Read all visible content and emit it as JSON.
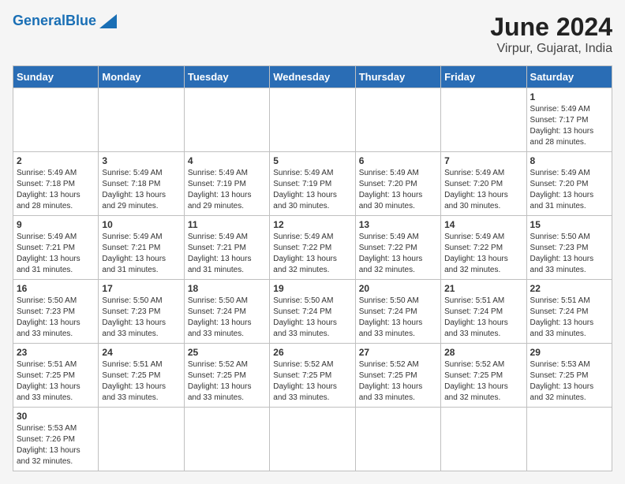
{
  "header": {
    "logo_general": "General",
    "logo_blue": "Blue",
    "month_year": "June 2024",
    "location": "Virpur, Gujarat, India"
  },
  "weekdays": [
    "Sunday",
    "Monday",
    "Tuesday",
    "Wednesday",
    "Thursday",
    "Friday",
    "Saturday"
  ],
  "weeks": [
    [
      {
        "day": null,
        "info": null
      },
      {
        "day": null,
        "info": null
      },
      {
        "day": null,
        "info": null
      },
      {
        "day": null,
        "info": null
      },
      {
        "day": null,
        "info": null
      },
      {
        "day": null,
        "info": null
      },
      {
        "day": "1",
        "info": "Sunrise: 5:49 AM\nSunset: 7:17 PM\nDaylight: 13 hours\nand 28 minutes."
      }
    ],
    [
      {
        "day": "2",
        "info": "Sunrise: 5:49 AM\nSunset: 7:18 PM\nDaylight: 13 hours\nand 28 minutes."
      },
      {
        "day": "3",
        "info": "Sunrise: 5:49 AM\nSunset: 7:18 PM\nDaylight: 13 hours\nand 29 minutes."
      },
      {
        "day": "4",
        "info": "Sunrise: 5:49 AM\nSunset: 7:19 PM\nDaylight: 13 hours\nand 29 minutes."
      },
      {
        "day": "5",
        "info": "Sunrise: 5:49 AM\nSunset: 7:19 PM\nDaylight: 13 hours\nand 30 minutes."
      },
      {
        "day": "6",
        "info": "Sunrise: 5:49 AM\nSunset: 7:20 PM\nDaylight: 13 hours\nand 30 minutes."
      },
      {
        "day": "7",
        "info": "Sunrise: 5:49 AM\nSunset: 7:20 PM\nDaylight: 13 hours\nand 30 minutes."
      },
      {
        "day": "8",
        "info": "Sunrise: 5:49 AM\nSunset: 7:20 PM\nDaylight: 13 hours\nand 31 minutes."
      }
    ],
    [
      {
        "day": "9",
        "info": "Sunrise: 5:49 AM\nSunset: 7:21 PM\nDaylight: 13 hours\nand 31 minutes."
      },
      {
        "day": "10",
        "info": "Sunrise: 5:49 AM\nSunset: 7:21 PM\nDaylight: 13 hours\nand 31 minutes."
      },
      {
        "day": "11",
        "info": "Sunrise: 5:49 AM\nSunset: 7:21 PM\nDaylight: 13 hours\nand 31 minutes."
      },
      {
        "day": "12",
        "info": "Sunrise: 5:49 AM\nSunset: 7:22 PM\nDaylight: 13 hours\nand 32 minutes."
      },
      {
        "day": "13",
        "info": "Sunrise: 5:49 AM\nSunset: 7:22 PM\nDaylight: 13 hours\nand 32 minutes."
      },
      {
        "day": "14",
        "info": "Sunrise: 5:49 AM\nSunset: 7:22 PM\nDaylight: 13 hours\nand 32 minutes."
      },
      {
        "day": "15",
        "info": "Sunrise: 5:50 AM\nSunset: 7:23 PM\nDaylight: 13 hours\nand 33 minutes."
      }
    ],
    [
      {
        "day": "16",
        "info": "Sunrise: 5:50 AM\nSunset: 7:23 PM\nDaylight: 13 hours\nand 33 minutes."
      },
      {
        "day": "17",
        "info": "Sunrise: 5:50 AM\nSunset: 7:23 PM\nDaylight: 13 hours\nand 33 minutes."
      },
      {
        "day": "18",
        "info": "Sunrise: 5:50 AM\nSunset: 7:24 PM\nDaylight: 13 hours\nand 33 minutes."
      },
      {
        "day": "19",
        "info": "Sunrise: 5:50 AM\nSunset: 7:24 PM\nDaylight: 13 hours\nand 33 minutes."
      },
      {
        "day": "20",
        "info": "Sunrise: 5:50 AM\nSunset: 7:24 PM\nDaylight: 13 hours\nand 33 minutes."
      },
      {
        "day": "21",
        "info": "Sunrise: 5:51 AM\nSunset: 7:24 PM\nDaylight: 13 hours\nand 33 minutes."
      },
      {
        "day": "22",
        "info": "Sunrise: 5:51 AM\nSunset: 7:24 PM\nDaylight: 13 hours\nand 33 minutes."
      }
    ],
    [
      {
        "day": "23",
        "info": "Sunrise: 5:51 AM\nSunset: 7:25 PM\nDaylight: 13 hours\nand 33 minutes."
      },
      {
        "day": "24",
        "info": "Sunrise: 5:51 AM\nSunset: 7:25 PM\nDaylight: 13 hours\nand 33 minutes."
      },
      {
        "day": "25",
        "info": "Sunrise: 5:52 AM\nSunset: 7:25 PM\nDaylight: 13 hours\nand 33 minutes."
      },
      {
        "day": "26",
        "info": "Sunrise: 5:52 AM\nSunset: 7:25 PM\nDaylight: 13 hours\nand 33 minutes."
      },
      {
        "day": "27",
        "info": "Sunrise: 5:52 AM\nSunset: 7:25 PM\nDaylight: 13 hours\nand 33 minutes."
      },
      {
        "day": "28",
        "info": "Sunrise: 5:52 AM\nSunset: 7:25 PM\nDaylight: 13 hours\nand 32 minutes."
      },
      {
        "day": "29",
        "info": "Sunrise: 5:53 AM\nSunset: 7:25 PM\nDaylight: 13 hours\nand 32 minutes."
      }
    ],
    [
      {
        "day": "30",
        "info": "Sunrise: 5:53 AM\nSunset: 7:26 PM\nDaylight: 13 hours\nand 32 minutes."
      },
      {
        "day": null,
        "info": null
      },
      {
        "day": null,
        "info": null
      },
      {
        "day": null,
        "info": null
      },
      {
        "day": null,
        "info": null
      },
      {
        "day": null,
        "info": null
      },
      {
        "day": null,
        "info": null
      }
    ]
  ]
}
